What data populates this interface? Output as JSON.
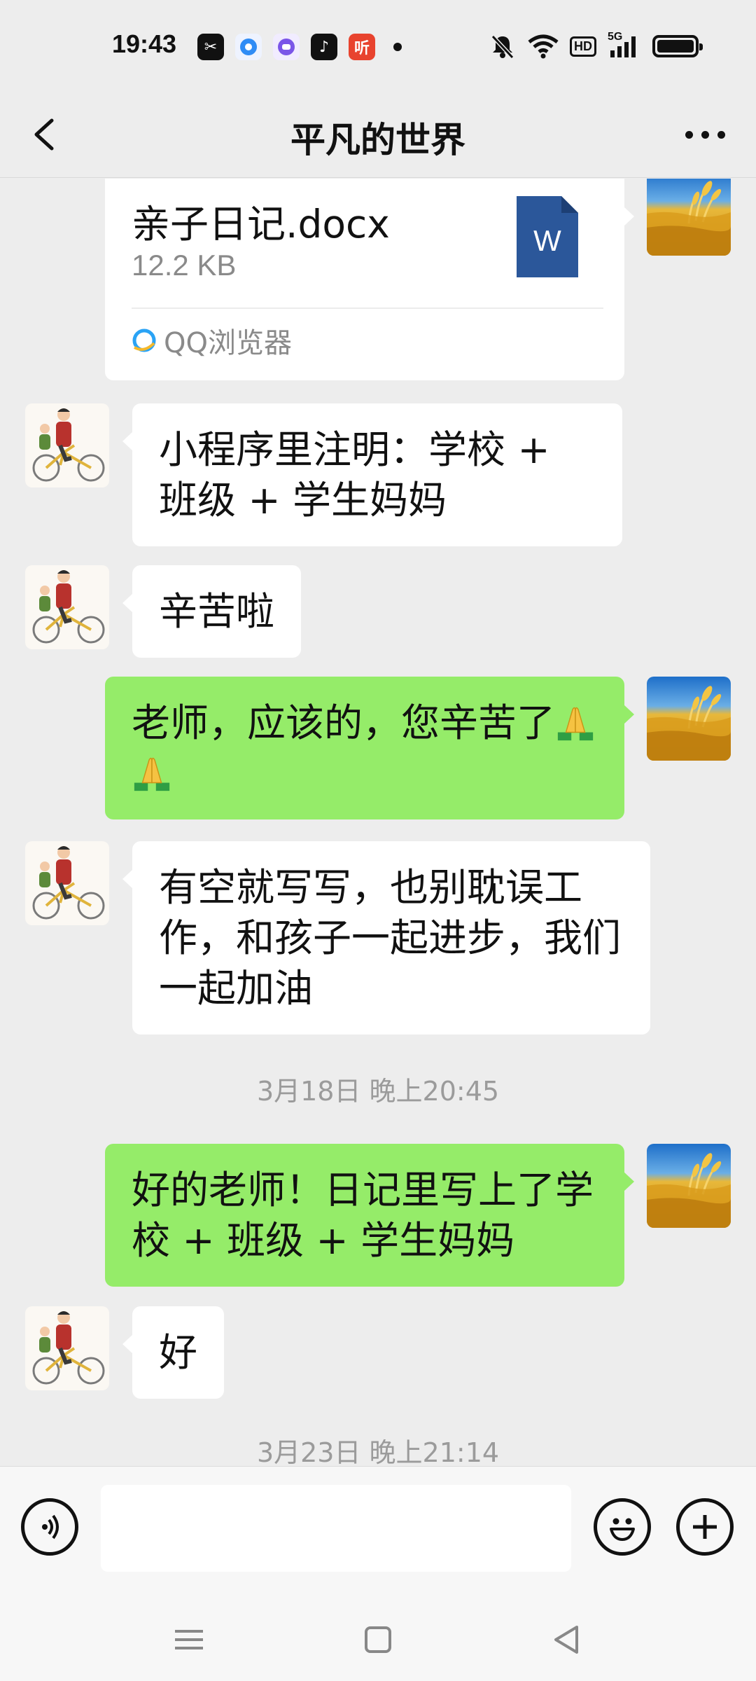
{
  "status_bar": {
    "time": "19:43",
    "notification_icons": [
      {
        "name": "capcut-icon",
        "color": "#111111",
        "glyph": "✂"
      },
      {
        "name": "browser-icon",
        "color": "#2f8cf5",
        "glyph": "◉"
      },
      {
        "name": "message-app-icon",
        "color": "#7a55e8",
        "glyph": "◙"
      },
      {
        "name": "tiktok-icon",
        "color": "#111111",
        "glyph": "♪"
      },
      {
        "name": "ting-app-icon",
        "color": "#e8432e",
        "glyph": "听"
      }
    ],
    "hd_label": "HD",
    "network_label": "5G"
  },
  "nav": {
    "title": "平凡的世界"
  },
  "file_message": {
    "file_name": "亲子日记.docx",
    "file_size": "12.2 KB",
    "file_type_letter": "W",
    "source": "QQ浏览器"
  },
  "messages": {
    "m1": "小程序里注明：学校 + 班级 + 学生妈妈",
    "m2": "辛苦啦",
    "m3": "老师，应该的，您辛苦了",
    "m4": "有空就写写，也别耽误工作，和孩子一起进步，我们一起加油",
    "m5": "好的老师！日记里写上了学校 + 班级 + 学生妈妈",
    "m6": "好"
  },
  "timestamps": {
    "t1": "3月18日 晚上20:45",
    "t2": "3月23日 晚上21:14"
  },
  "input": {
    "value": "",
    "placeholder": ""
  },
  "colors": {
    "outgoing_bubble": "#95ec69",
    "incoming_bubble": "#ffffff",
    "background": "#ededed",
    "word_blue": "#2b579a"
  }
}
